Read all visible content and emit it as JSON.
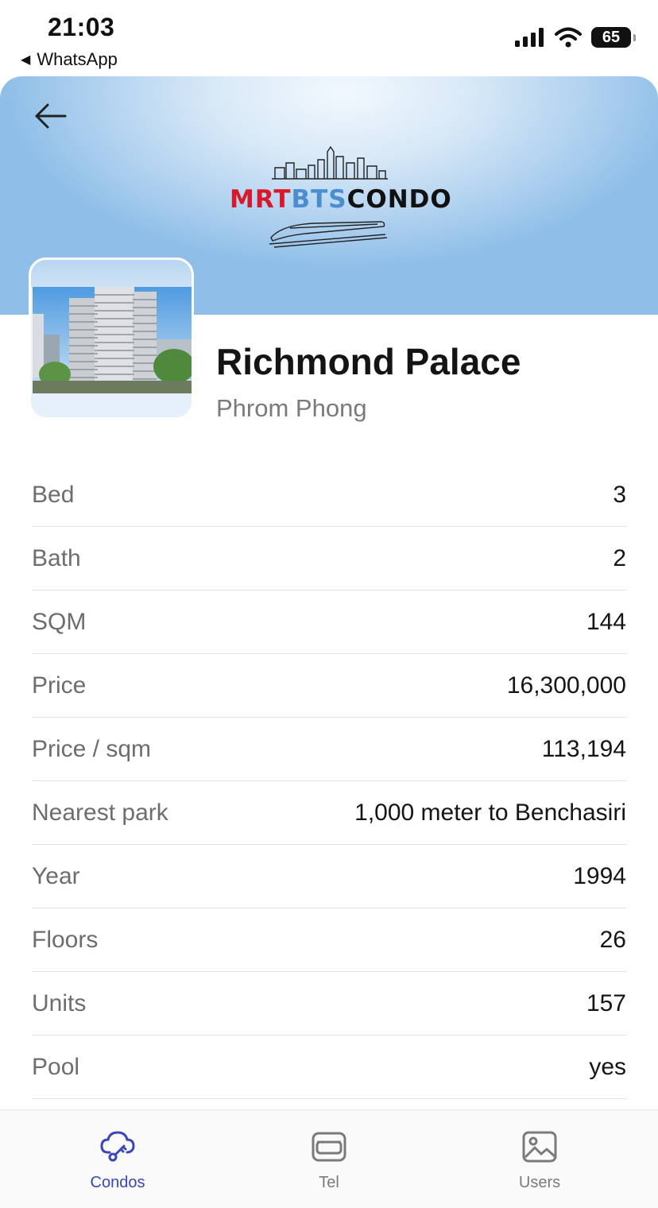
{
  "status_bar": {
    "time": "21:03",
    "back_app": "WhatsApp",
    "battery": "65"
  },
  "header": {
    "logo": {
      "part1": "MRT",
      "part2": "BTS",
      "part3": "CONDO"
    }
  },
  "condo": {
    "name": "Richmond Palace",
    "area": "Phrom Phong"
  },
  "details": [
    {
      "label": "Bed",
      "value": "3"
    },
    {
      "label": "Bath",
      "value": "2"
    },
    {
      "label": "SQM",
      "value": "144"
    },
    {
      "label": "Price",
      "value": "16,300,000"
    },
    {
      "label": "Price / sqm",
      "value": "113,194"
    },
    {
      "label": "Nearest park",
      "value": "1,000 meter to Benchasiri"
    },
    {
      "label": "Year",
      "value": "1994"
    },
    {
      "label": "Floors",
      "value": "26"
    },
    {
      "label": "Units",
      "value": "157"
    },
    {
      "label": "Pool",
      "value": "yes"
    }
  ],
  "tabs": [
    {
      "label": "Condos",
      "icon": "cloud-key-icon",
      "active": true
    },
    {
      "label": "Tel",
      "icon": "card-icon",
      "active": false
    },
    {
      "label": "Users",
      "icon": "image-icon",
      "active": false
    }
  ],
  "colors": {
    "accent": "#3a47b5",
    "logo_red": "#d8192a",
    "logo_blue": "#4a8ed0"
  }
}
